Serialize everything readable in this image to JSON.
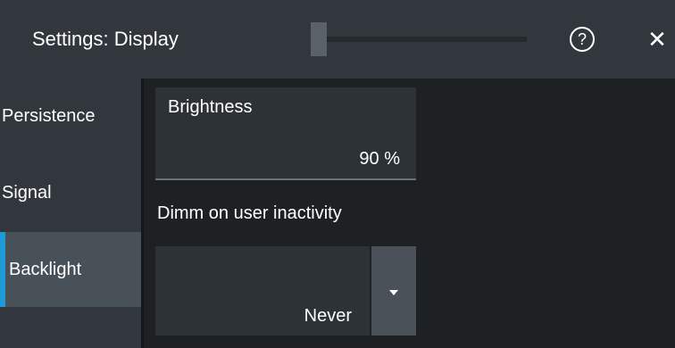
{
  "titlebar": {
    "title": "Settings: Display",
    "help_icon": "help-circle-icon",
    "help_glyph": "?",
    "close_icon": "close-icon",
    "close_glyph": "✕"
  },
  "sidebar": {
    "items": [
      {
        "label": "Persistence",
        "selected": false
      },
      {
        "label": "Signal",
        "selected": false
      },
      {
        "label": "Backlight",
        "selected": true
      }
    ]
  },
  "brightness": {
    "label": "Brightness",
    "value": "90 %"
  },
  "dimm": {
    "label": "Dimm on user inactivity",
    "value": "Never",
    "arrow_icon": "dropdown-arrow-icon"
  },
  "colors": {
    "accent": "#1e9ad6",
    "panel": "#32373d",
    "background": "#1e2124"
  }
}
